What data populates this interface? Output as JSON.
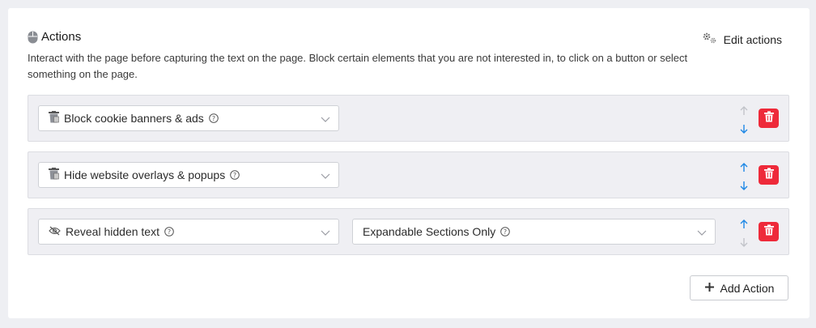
{
  "header": {
    "title": "Actions",
    "edit_label": "Edit actions",
    "description": "Interact with the page before capturing the text on the page. Block certain elements that you are not interested in, to click on a button or select something on the page."
  },
  "actions": [
    {
      "label": "Block cookie banners & ads",
      "icon": "trash-can-icon",
      "up_enabled": false,
      "down_enabled": true
    },
    {
      "label": "Hide website overlays & popups",
      "icon": "trash-can-icon",
      "up_enabled": true,
      "down_enabled": true
    },
    {
      "label": "Reveal hidden text",
      "icon": "eye-slash-icon",
      "option": "Expandable Sections Only",
      "up_enabled": true,
      "down_enabled": false
    }
  ],
  "footer": {
    "add_label": "Add Action"
  },
  "colors": {
    "accent": "#1e88e5",
    "delete": "#ee2a3a",
    "disabled_arrow": "#b5b8bf",
    "row_bg": "#efeff3"
  }
}
